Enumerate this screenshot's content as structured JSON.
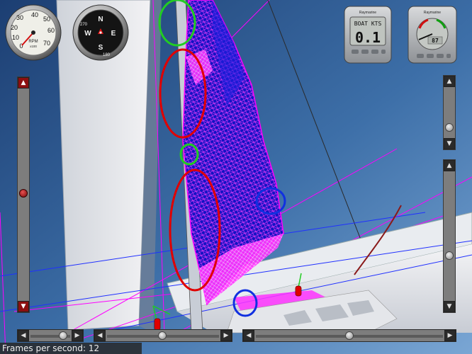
{
  "instruments": {
    "tachometer": {
      "scale": [
        "0",
        "10",
        "20",
        "30",
        "40",
        "50",
        "60",
        "70"
      ],
      "unit": "RPM",
      "multiplier": "x100"
    },
    "compass": {
      "north": "N",
      "south": "S",
      "east": "E",
      "west": "W",
      "degrees": [
        "270",
        "180"
      ]
    },
    "speed_display": {
      "brand": "Raymarine",
      "label": "BOAT KTS",
      "value": "0.1"
    },
    "wind_display": {
      "brand": "Raymarine",
      "value": "87"
    }
  },
  "status": {
    "fps_text": "Frames per second: 12"
  },
  "scrollbar_icons": {
    "up": "▲",
    "down": "▼",
    "left": "◀",
    "right": "▶"
  },
  "colors": {
    "sky": "#3d6fa8",
    "sail_mesh": "#1010c8",
    "wire_magenta": "#ff00ff",
    "marker_red": "#e00000",
    "marker_green": "#22cc22",
    "marker_blue": "#1030e0"
  }
}
